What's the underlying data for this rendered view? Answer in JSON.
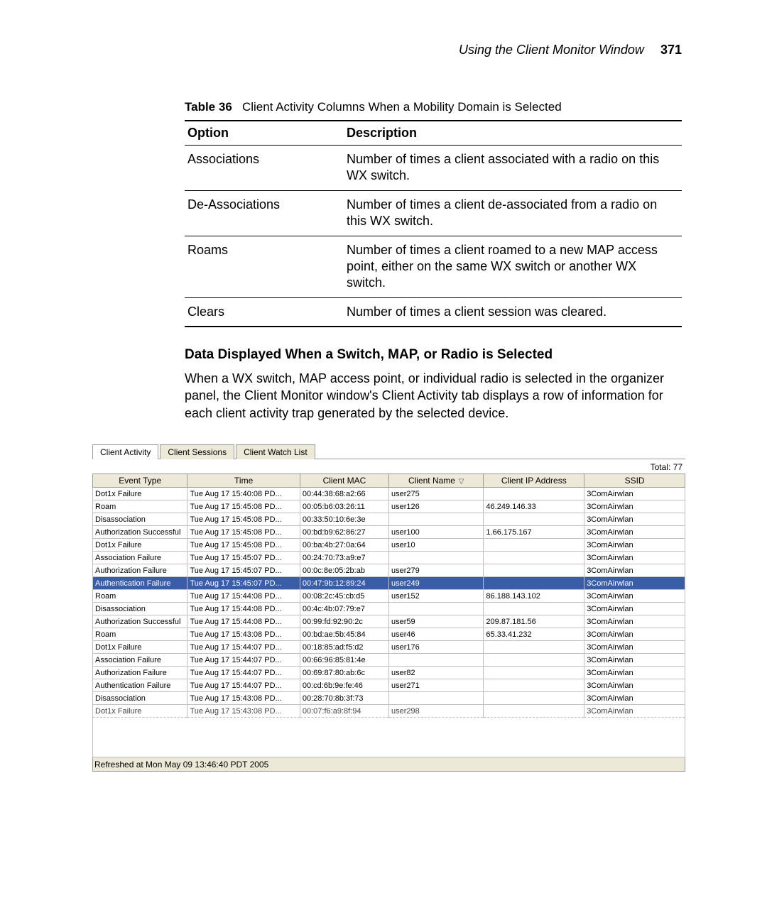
{
  "header": {
    "title": "Using the Client Monitor Window",
    "page_number": "371"
  },
  "doc_table": {
    "caption_bold": "Table 36",
    "caption_rest": "Client Activity Columns When a Mobility Domain is Selected",
    "col1": "Option",
    "col2": "Description",
    "rows": [
      {
        "opt": "Associations",
        "desc": "Number of times a client associated with a radio on this WX switch."
      },
      {
        "opt": "De-Associations",
        "desc": "Number of times a client de-associated from a radio on this WX switch."
      },
      {
        "opt": "Roams",
        "desc": "Number of times a client roamed to a new MAP access point, either on the same WX switch or another WX switch."
      },
      {
        "opt": "Clears",
        "desc": "Number of times a client session was cleared."
      }
    ]
  },
  "section": {
    "heading": "Data Displayed When a Switch, MAP, or Radio is Selected",
    "para": "When a WX switch, MAP access point, or individual radio is selected in the organizer panel, the Client Monitor window's Client Activity tab displays a row of information for each client activity trap generated by the selected device."
  },
  "screenshot": {
    "tabs": [
      "Client Activity",
      "Client Sessions",
      "Client Watch List"
    ],
    "active_tab_index": 0,
    "total_label": "Total: 77",
    "columns": [
      "Event Type",
      "Time",
      "Client MAC",
      "Client Name",
      "Client IP Address",
      "SSID"
    ],
    "sorted_col_index": 3,
    "rows": [
      {
        "event": "Dot1x Failure",
        "time": "Tue Aug 17 15:40:08 PD...",
        "mac": "00:44:38:68:a2:66",
        "name": "user275",
        "ip": "",
        "ssid": "3ComAirwlan",
        "sel": false
      },
      {
        "event": "Roam",
        "time": "Tue Aug 17 15:45:08 PD...",
        "mac": "00:05:b6:03:26:11",
        "name": "user126",
        "ip": "46.249.146.33",
        "ssid": "3ComAirwlan",
        "sel": false
      },
      {
        "event": "Disassociation",
        "time": "Tue Aug 17 15:45:08 PD...",
        "mac": "00:33:50:10:6e:3e",
        "name": "",
        "ip": "",
        "ssid": "3ComAirwlan",
        "sel": false
      },
      {
        "event": "Authorization Successful",
        "time": "Tue Aug 17 15:45:08 PD...",
        "mac": "00:bd:b9:62:86:27",
        "name": "user100",
        "ip": "1.66.175.167",
        "ssid": "3ComAirwlan",
        "sel": false
      },
      {
        "event": "Dot1x Failure",
        "time": "Tue Aug 17 15:45:08 PD...",
        "mac": "00:ba:4b:27:0a:64",
        "name": "user10",
        "ip": "",
        "ssid": "3ComAirwlan",
        "sel": false
      },
      {
        "event": "Association Failure",
        "time": "Tue Aug 17 15:45:07 PD...",
        "mac": "00:24:70:73:a9:e7",
        "name": "",
        "ip": "",
        "ssid": "3ComAirwlan",
        "sel": false
      },
      {
        "event": "Authorization Failure",
        "time": "Tue Aug 17 15:45:07 PD...",
        "mac": "00:0c:8e:05:2b:ab",
        "name": "user279",
        "ip": "",
        "ssid": "3ComAirwlan",
        "sel": false
      },
      {
        "event": "Authentication Failure",
        "time": "Tue Aug 17 15:45:07 PD...",
        "mac": "00:47:9b:12:89:24",
        "name": "user249",
        "ip": "",
        "ssid": "3ComAirwlan",
        "sel": true
      },
      {
        "event": "Roam",
        "time": "Tue Aug 17 15:44:08 PD...",
        "mac": "00:08:2c:45:cb:d5",
        "name": "user152",
        "ip": "86.188.143.102",
        "ssid": "3ComAirwlan",
        "sel": false
      },
      {
        "event": "Disassociation",
        "time": "Tue Aug 17 15:44:08 PD...",
        "mac": "00:4c:4b:07:79:e7",
        "name": "",
        "ip": "",
        "ssid": "3ComAirwlan",
        "sel": false
      },
      {
        "event": "Authorization Successful",
        "time": "Tue Aug 17 15:44:08 PD...",
        "mac": "00:99:fd:92:90:2c",
        "name": "user59",
        "ip": "209.87.181.56",
        "ssid": "3ComAirwlan",
        "sel": false
      },
      {
        "event": "Roam",
        "time": "Tue Aug 17 15:43:08 PD...",
        "mac": "00:bd:ae:5b:45:84",
        "name": "user46",
        "ip": "65.33.41.232",
        "ssid": "3ComAirwlan",
        "sel": false
      },
      {
        "event": "Dot1x Failure",
        "time": "Tue Aug 17 15:44:07 PD...",
        "mac": "00:18:85:ad:f5:d2",
        "name": "user176",
        "ip": "",
        "ssid": "3ComAirwlan",
        "sel": false
      },
      {
        "event": "Association Failure",
        "time": "Tue Aug 17 15:44:07 PD...",
        "mac": "00:66:96:85:81:4e",
        "name": "",
        "ip": "",
        "ssid": "3ComAirwlan",
        "sel": false
      },
      {
        "event": "Authorization Failure",
        "time": "Tue Aug 17 15:44:07 PD...",
        "mac": "00:69:87:80:ab:6c",
        "name": "user82",
        "ip": "",
        "ssid": "3ComAirwlan",
        "sel": false
      },
      {
        "event": "Authentication Failure",
        "time": "Tue Aug 17 15:44:07 PD...",
        "mac": "00:cd:6b:9e:fe:46",
        "name": "user271",
        "ip": "",
        "ssid": "3ComAirwlan",
        "sel": false
      },
      {
        "event": "Disassociation",
        "time": "Tue Aug 17 15:43:08 PD...",
        "mac": "00:28:70:8b:3f:73",
        "name": "",
        "ip": "",
        "ssid": "3ComAirwlan",
        "sel": false
      },
      {
        "event": "Dot1x Failure",
        "time": "Tue Aug 17 15:43:08 PD...",
        "mac": "00:07:f6:a9:8f:94",
        "name": "user298",
        "ip": "",
        "ssid": "3ComAirwlan",
        "sel": false,
        "cutoff": true
      }
    ],
    "refresh_line": "Refreshed at Mon May 09 13:46:40 PDT 2005"
  }
}
